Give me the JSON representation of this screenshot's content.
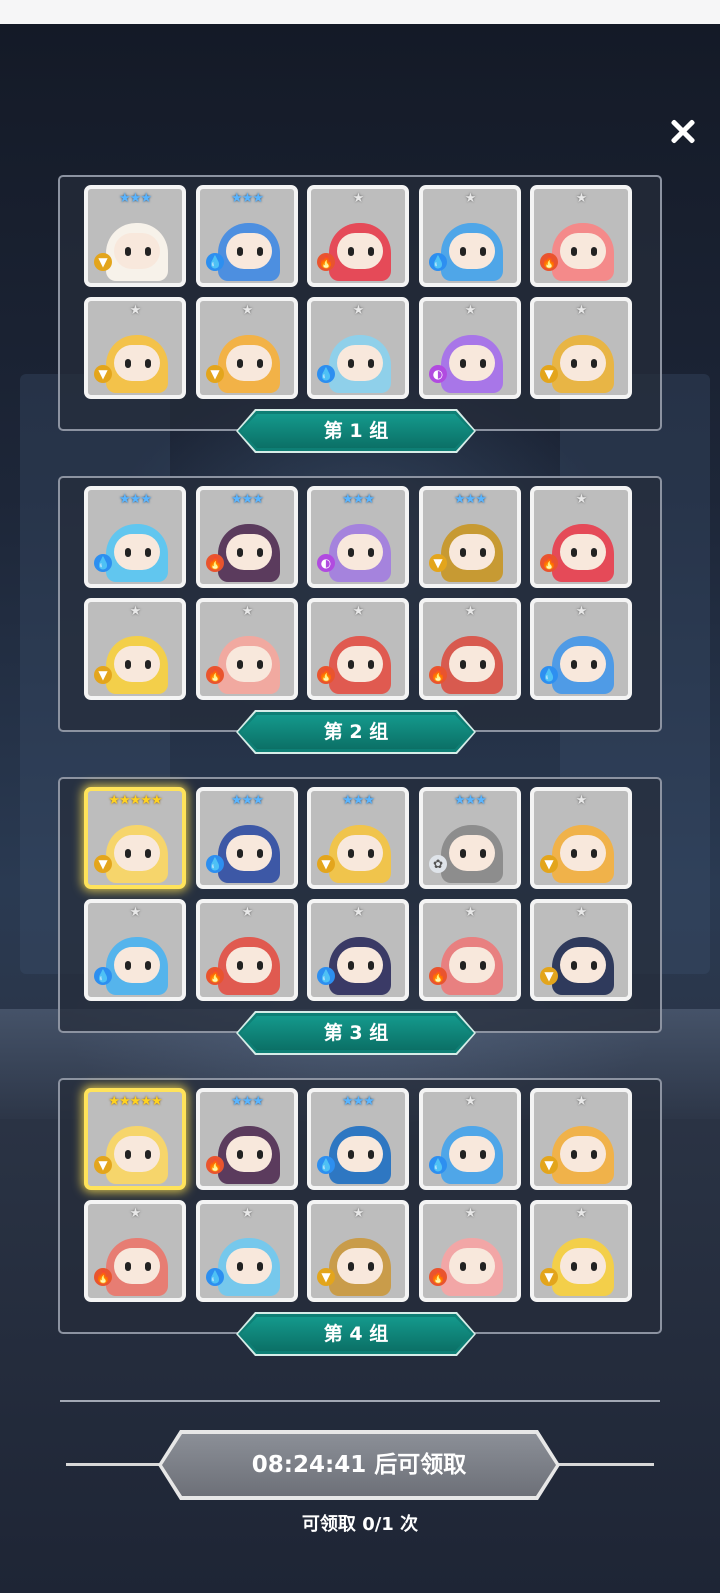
{
  "groups": [
    {
      "label": "第 1 组",
      "slots": [
        {
          "stars": "★★★",
          "star_color": "blue",
          "element": "earth",
          "color": "#f7f2ea",
          "gold": false
        },
        {
          "stars": "★★★",
          "star_color": "blue",
          "element": "water",
          "color": "#4d8fe0",
          "gold": false
        },
        {
          "stars": "★",
          "star_color": "silver",
          "element": "fire",
          "color": "#e54a58",
          "gold": false
        },
        {
          "stars": "★",
          "star_color": "silver",
          "element": "water",
          "color": "#4fa6e8",
          "gold": false
        },
        {
          "stars": "★",
          "star_color": "silver",
          "element": "fire",
          "color": "#f48a8a",
          "gold": false
        },
        {
          "stars": "★",
          "star_color": "silver",
          "element": "earth",
          "color": "#f3c24a",
          "gold": false
        },
        {
          "stars": "★",
          "star_color": "silver",
          "element": "earth",
          "color": "#f2b247",
          "gold": false
        },
        {
          "stars": "★",
          "star_color": "silver",
          "element": "water",
          "color": "#8fd0ea",
          "gold": false
        },
        {
          "stars": "★",
          "star_color": "silver",
          "element": "dark",
          "color": "#a876e8",
          "gold": false
        },
        {
          "stars": "★",
          "star_color": "silver",
          "element": "earth",
          "color": "#e8b545",
          "gold": false
        }
      ]
    },
    {
      "label": "第 2 组",
      "slots": [
        {
          "stars": "★★★",
          "star_color": "blue",
          "element": "water",
          "color": "#61c6ef",
          "gold": false
        },
        {
          "stars": "★★★",
          "star_color": "blue",
          "element": "fire",
          "color": "#5b3b5d",
          "gold": false
        },
        {
          "stars": "★★★",
          "star_color": "blue",
          "element": "dark",
          "color": "#a583dd",
          "gold": false
        },
        {
          "stars": "★★★",
          "star_color": "blue",
          "element": "earth",
          "color": "#c79a33",
          "gold": false
        },
        {
          "stars": "★",
          "star_color": "silver",
          "element": "fire",
          "color": "#e54a58",
          "gold": false
        },
        {
          "stars": "★",
          "star_color": "silver",
          "element": "earth",
          "color": "#f3cf4a",
          "gold": false
        },
        {
          "stars": "★",
          "star_color": "silver",
          "element": "fire",
          "color": "#f1a9a0",
          "gold": false
        },
        {
          "stars": "★",
          "star_color": "silver",
          "element": "fire",
          "color": "#e05a50",
          "gold": false
        },
        {
          "stars": "★",
          "star_color": "silver",
          "element": "fire",
          "color": "#d85a4f",
          "gold": false
        },
        {
          "stars": "★",
          "star_color": "silver",
          "element": "water",
          "color": "#4f9be6",
          "gold": false
        }
      ]
    },
    {
      "label": "第 3 组",
      "slots": [
        {
          "stars": "★★★★★",
          "star_color": "gold",
          "element": "earth",
          "color": "#f6d56b",
          "gold": true
        },
        {
          "stars": "★★★",
          "star_color": "blue",
          "element": "water",
          "color": "#3d58a6",
          "gold": false
        },
        {
          "stars": "★★★",
          "star_color": "blue",
          "element": "earth",
          "color": "#f0c44c",
          "gold": false
        },
        {
          "stars": "★★★",
          "star_color": "blue",
          "element": "light",
          "color": "#8d8d8d",
          "gold": false
        },
        {
          "stars": "★",
          "star_color": "silver",
          "element": "earth",
          "color": "#f0b24a",
          "gold": false
        },
        {
          "stars": "★",
          "star_color": "silver",
          "element": "water",
          "color": "#55b4ec",
          "gold": false
        },
        {
          "stars": "★",
          "star_color": "silver",
          "element": "fire",
          "color": "#e05a50",
          "gold": false
        },
        {
          "stars": "★",
          "star_color": "silver",
          "element": "water",
          "color": "#3a3a66",
          "gold": false
        },
        {
          "stars": "★",
          "star_color": "silver",
          "element": "fire",
          "color": "#e88080",
          "gold": false
        },
        {
          "stars": "★",
          "star_color": "silver",
          "element": "earth",
          "color": "#2f3a5c",
          "gold": false
        }
      ]
    },
    {
      "label": "第 4 组",
      "slots": [
        {
          "stars": "★★★★★",
          "star_color": "gold",
          "element": "earth",
          "color": "#f6d56b",
          "gold": true
        },
        {
          "stars": "★★★",
          "star_color": "blue",
          "element": "fire",
          "color": "#5b3b5d",
          "gold": false
        },
        {
          "stars": "★★★",
          "star_color": "blue",
          "element": "water",
          "color": "#2e77c2",
          "gold": false
        },
        {
          "stars": "★",
          "star_color": "silver",
          "element": "water",
          "color": "#4fa6e8",
          "gold": false
        },
        {
          "stars": "★",
          "star_color": "silver",
          "element": "earth",
          "color": "#f0b24a",
          "gold": false
        },
        {
          "stars": "★",
          "star_color": "silver",
          "element": "fire",
          "color": "#e77d73",
          "gold": false
        },
        {
          "stars": "★",
          "star_color": "silver",
          "element": "water",
          "color": "#76c8ec",
          "gold": false
        },
        {
          "stars": "★",
          "star_color": "silver",
          "element": "earth",
          "color": "#c99c4a",
          "gold": false
        },
        {
          "stars": "★",
          "star_color": "silver",
          "element": "fire",
          "color": "#f2a6a6",
          "gold": false
        },
        {
          "stars": "★",
          "star_color": "silver",
          "element": "earth",
          "color": "#f3cf4a",
          "gold": false
        }
      ]
    }
  ],
  "claim": {
    "button_label": "08:24:41 后可领取",
    "count_label": "可领取 0/1 次"
  },
  "element_icons": {
    "water": "💧",
    "fire": "🔥",
    "earth": "▼",
    "dark": "◐",
    "light": "✿"
  },
  "colors": {
    "teal": "#0e7f75",
    "panel_border": "#8c93a1",
    "gold_frame": "#ffe35a"
  }
}
